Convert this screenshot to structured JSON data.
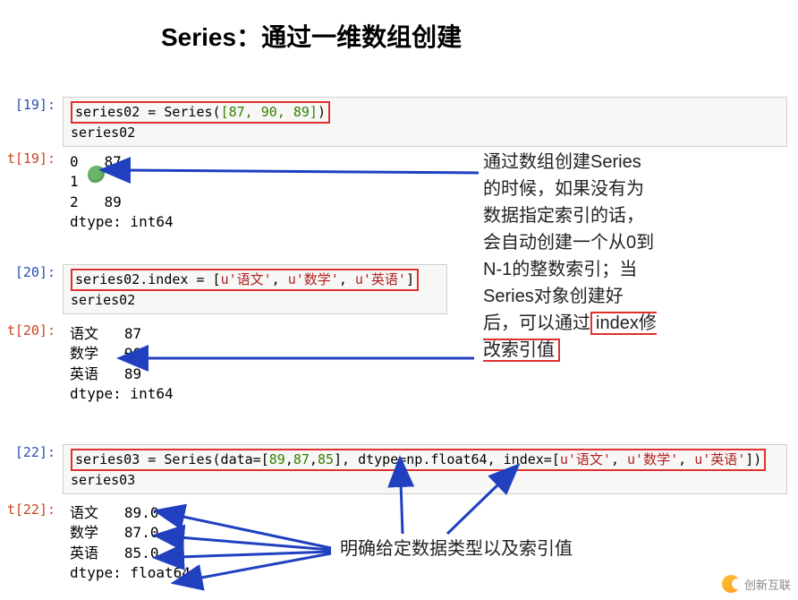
{
  "title": "Series：通过一维数组创建",
  "cells": {
    "in19": {
      "prompt": "[19]:",
      "boxed": "series02 = Series([87, 90, 89])",
      "line2": "series02"
    },
    "out19": {
      "prompt": "t[19]:",
      "rows": [
        {
          "idx": "0",
          "val": "87"
        },
        {
          "idx": "1",
          "val": ""
        },
        {
          "idx": "2",
          "val": "89"
        }
      ],
      "dtype": "dtype: int64"
    },
    "in20": {
      "prompt": "[20]:",
      "boxed": "series02.index = [u'语文', u'数学', u'英语']",
      "line2": "series02"
    },
    "out20": {
      "prompt": "t[20]:",
      "rows": [
        {
          "idx": "语文",
          "val": "87"
        },
        {
          "idx": "数学",
          "val": "90"
        },
        {
          "idx": "英语",
          "val": "89"
        }
      ],
      "dtype": "dtype: int64"
    },
    "in22": {
      "prompt": "[22]:",
      "boxed": "series03 = Series(data=[89,87,85], dtype=np.float64, index=[u'语文', u'数学', u'英语'])",
      "line2": "series03"
    },
    "out22": {
      "prompt": "t[22]:",
      "rows": [
        {
          "idx": "语文",
          "val": "89.0"
        },
        {
          "idx": "数学",
          "val": "87.0"
        },
        {
          "idx": "英语",
          "val": "85.0"
        }
      ],
      "dtype": "dtype: float64"
    }
  },
  "note1": {
    "l1": "通过数组创建Series",
    "l2": "的时候，如果没有为",
    "l3": "数据指定索引的话，",
    "l4": "会自动创建一个从0到",
    "l5": "N-1的整数索引；当",
    "l6": "Series对象创建好",
    "l7a": "后，可以通过",
    "l7b": "index修",
    "l8": "改索引值"
  },
  "note2": "明确给定数据类型以及索引值",
  "watermark": "创新互联"
}
